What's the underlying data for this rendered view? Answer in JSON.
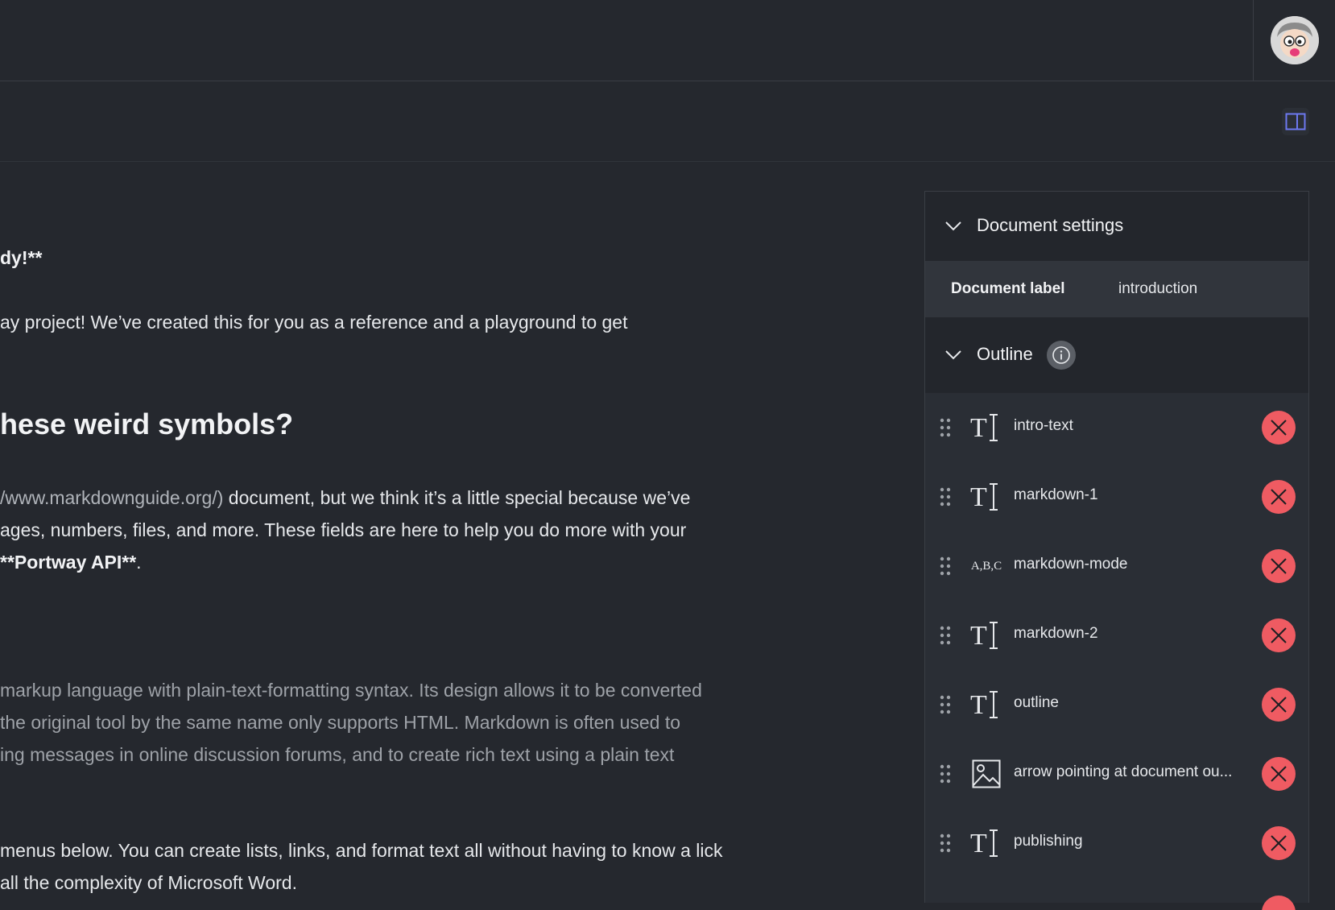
{
  "header": {
    "avatar_icon": "cartoon-avatar-icon"
  },
  "toolbar": {
    "panel_toggle_icon": "sidebar-toggle-icon",
    "accent": "#6d78f0"
  },
  "document": {
    "line1": "dy!**",
    "line2": "ay project! We’ve created this for you as a reference and a playground to get",
    "heading": "hese weird symbols?",
    "p2a_link": "/www.markdownguide.org/)",
    "p2a_rest": " document, but we think it’s a little special because we’ve",
    "p2b": "ages, numbers, files, and more. These fields are here to help you do more with your",
    "p2c_bold": "**Portway API**",
    "p2c_end": ".",
    "q1": " markup language with plain-text-formatting syntax. Its design allows it to be converted",
    "q2": " the original tool by the same name only supports HTML. Markdown is often used to",
    "q3": "ing messages in online discussion forums, and to create rich text using a plain text",
    "p3a": "menus below. You can create lists, links, and format text all without having to know a lick",
    "p3b": "all the complexity of Microsoft Word."
  },
  "sidebar": {
    "settings_title": "Document settings",
    "label_key": "Document label",
    "label_value": "introduction",
    "outline_title": "Outline",
    "items": [
      {
        "name": "intro-text",
        "icon": "text-field-icon"
      },
      {
        "name": "markdown-1",
        "icon": "text-field-icon"
      },
      {
        "name": "markdown-mode",
        "icon": "abc-field-icon"
      },
      {
        "name": "markdown-2",
        "icon": "text-field-icon"
      },
      {
        "name": "outline",
        "icon": "text-field-icon"
      },
      {
        "name": "arrow pointing at document ou...",
        "icon": "image-field-icon"
      },
      {
        "name": "publishing",
        "icon": "text-field-icon"
      }
    ],
    "abc_glyph": "A,B,C",
    "delete_color": "#ef5b62"
  }
}
